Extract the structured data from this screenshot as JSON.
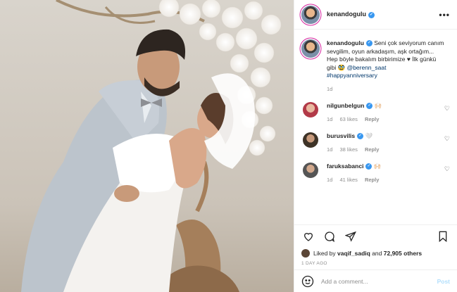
{
  "header": {
    "username": "kenandogulu",
    "more_label": "•••"
  },
  "caption": {
    "username": "kenandogulu",
    "text_1": "Seni çok seviyorum canım sevgilim, oyun arkadaşım, aşk ortağım...",
    "text_2": "Hep böyle bakalım birbirimize ♥ İlk günkü gibi 🥸",
    "mention": "@berenn_saat",
    "hashtag": "#happyanniversary",
    "time": "1d"
  },
  "comments": [
    {
      "username": "nilgunbelgun",
      "text": "🙌🏻",
      "time": "1d",
      "likes": "63 likes",
      "reply": "Reply",
      "avatar_color": "#b23a48"
    },
    {
      "username": "burusvilis",
      "text": "🤍",
      "time": "1d",
      "likes": "38 likes",
      "reply": "Reply",
      "avatar_color": "#3e3327"
    },
    {
      "username": "faruksabanci",
      "text": "🙌🏻",
      "time": "1d",
      "likes": "41 likes",
      "reply": "Reply",
      "avatar_color": "#555555"
    }
  ],
  "likes": {
    "prefix": "Liked by",
    "user": "vaqif_sadiq",
    "middle": "and",
    "count": "72,905 others"
  },
  "posted_ago": "1 DAY AGO",
  "add_comment": {
    "placeholder": "Add a comment...",
    "post_label": "Post"
  },
  "colors": {
    "verified": "#3897f0",
    "link": "#00376b",
    "post_disabled": "#b2dffc"
  }
}
